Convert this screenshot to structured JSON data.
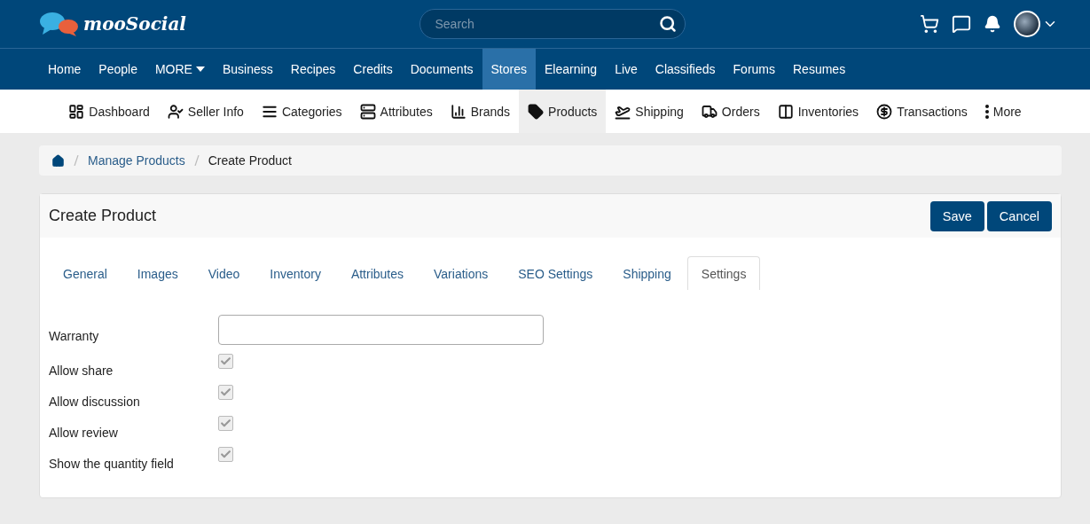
{
  "header": {
    "logo": "mooSocial",
    "search": {
      "placeholder": "Search"
    }
  },
  "nav": [
    {
      "label": "Home",
      "selected": false
    },
    {
      "label": "People",
      "selected": false
    },
    {
      "label": "MORE",
      "selected": false,
      "kind": "dropdown"
    },
    {
      "label": "Business",
      "selected": false
    },
    {
      "label": "Recipes",
      "selected": false
    },
    {
      "label": "Credits",
      "selected": false
    },
    {
      "label": "Documents",
      "selected": false
    },
    {
      "label": "Stores",
      "selected": true
    },
    {
      "label": "Elearning",
      "selected": false
    },
    {
      "label": "Live",
      "selected": false
    },
    {
      "label": "Classifieds",
      "selected": false
    },
    {
      "label": "Forums",
      "selected": false
    },
    {
      "label": "Resumes",
      "selected": false
    }
  ],
  "store_menu": [
    {
      "label": "Dashboard",
      "selected": false
    },
    {
      "label": "Seller Info",
      "selected": false
    },
    {
      "label": "Categories",
      "selected": false
    },
    {
      "label": "Attributes",
      "selected": false
    },
    {
      "label": "Brands",
      "selected": false
    },
    {
      "label": "Products",
      "selected": true
    },
    {
      "label": "Shipping",
      "selected": false
    },
    {
      "label": "Orders",
      "selected": false
    },
    {
      "label": "Inventories",
      "selected": false
    },
    {
      "label": "Transactions",
      "selected": false
    },
    {
      "label": "More",
      "selected": false
    }
  ],
  "breadcrumb": [
    "Manage Products",
    "Create Product"
  ],
  "card": {
    "title": "Create Product",
    "buttons": [
      "Save",
      "Cancel"
    ],
    "tabs": [
      {
        "label": "General",
        "selected": false
      },
      {
        "label": "Images",
        "selected": false
      },
      {
        "label": "Video",
        "selected": false
      },
      {
        "label": "Inventory",
        "selected": false
      },
      {
        "label": "Attributes",
        "selected": false
      },
      {
        "label": "Variations",
        "selected": false
      },
      {
        "label": "SEO Settings",
        "selected": false
      },
      {
        "label": "Shipping",
        "selected": false
      },
      {
        "label": "Settings",
        "selected": true
      }
    ],
    "fields": [
      {
        "kind": "text",
        "label": "Warranty"
      },
      {
        "kind": "checkbox",
        "label": "Allow share",
        "checked": true,
        "disabled": true
      },
      {
        "kind": "checkbox",
        "label": "Allow discussion",
        "checked": true,
        "disabled": true
      },
      {
        "kind": "checkbox",
        "label": "Allow review",
        "checked": true,
        "disabled": true
      },
      {
        "kind": "checkbox",
        "label": "Show the quantity field",
        "checked": true,
        "disabled": true
      }
    ]
  }
}
